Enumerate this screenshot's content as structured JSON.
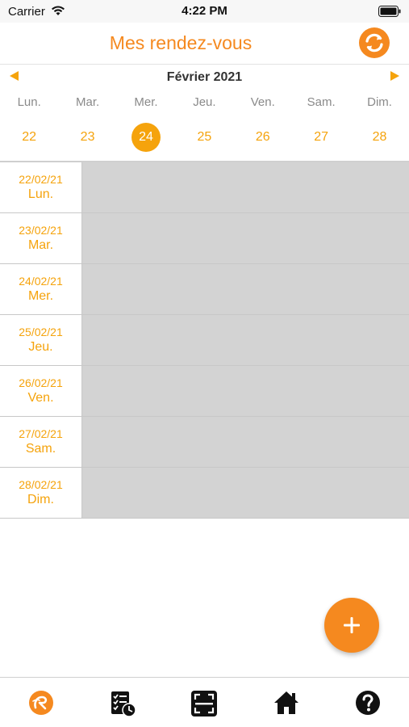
{
  "status_bar": {
    "carrier": "Carrier",
    "time": "4:22 PM"
  },
  "header": {
    "title": "Mes rendez-vous",
    "sync_icon": "sync-icon"
  },
  "calendar": {
    "month": "Février 2021",
    "weekdays": [
      "Lun.",
      "Mar.",
      "Mer.",
      "Jeu.",
      "Ven.",
      "Sam.",
      "Dim."
    ],
    "days": [
      "22",
      "23",
      "24",
      "25",
      "26",
      "27",
      "28"
    ],
    "selected_day": "24"
  },
  "agenda": [
    {
      "date": "22/02/21",
      "weekday": "Lun."
    },
    {
      "date": "23/02/21",
      "weekday": "Mar."
    },
    {
      "date": "24/02/21",
      "weekday": "Mer."
    },
    {
      "date": "25/02/21",
      "weekday": "Jeu."
    },
    {
      "date": "26/02/21",
      "weekday": "Ven."
    },
    {
      "date": "27/02/21",
      "weekday": "Sam."
    },
    {
      "date": "28/02/21",
      "weekday": "Dim."
    }
  ],
  "fab": {
    "icon": "plus-icon"
  },
  "tabbar": {
    "items": [
      "appointments-logo-icon",
      "checklist-clock-icon",
      "scan-icon",
      "home-icon",
      "help-icon"
    ]
  },
  "colors": {
    "accent": "#f5891f",
    "calendar_accent": "#f5a30c",
    "slot_gray": "#d3d3d3"
  }
}
